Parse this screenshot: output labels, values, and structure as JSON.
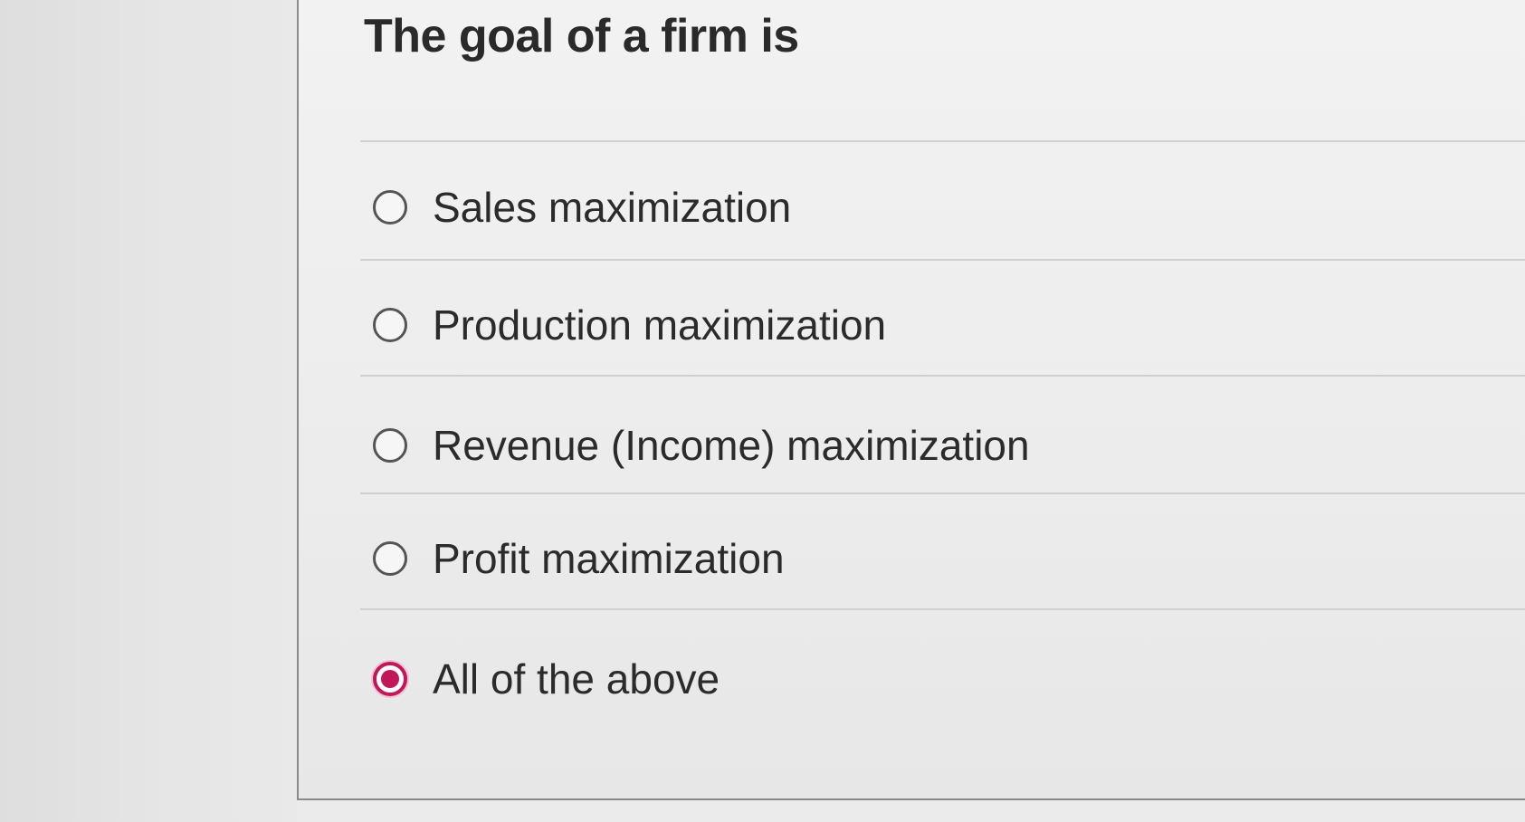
{
  "question": {
    "title": "The goal of a firm is"
  },
  "options": [
    {
      "label": "Sales maximization",
      "selected": false
    },
    {
      "label": "Production maximization",
      "selected": false
    },
    {
      "label": "Revenue (Income) maximization",
      "selected": false
    },
    {
      "label": "Profit maximization",
      "selected": false
    },
    {
      "label": "All of the above",
      "selected": true
    }
  ],
  "colors": {
    "selected_accent": "#c2185b",
    "radio_border": "#555555",
    "text": "#2b2b2b"
  }
}
